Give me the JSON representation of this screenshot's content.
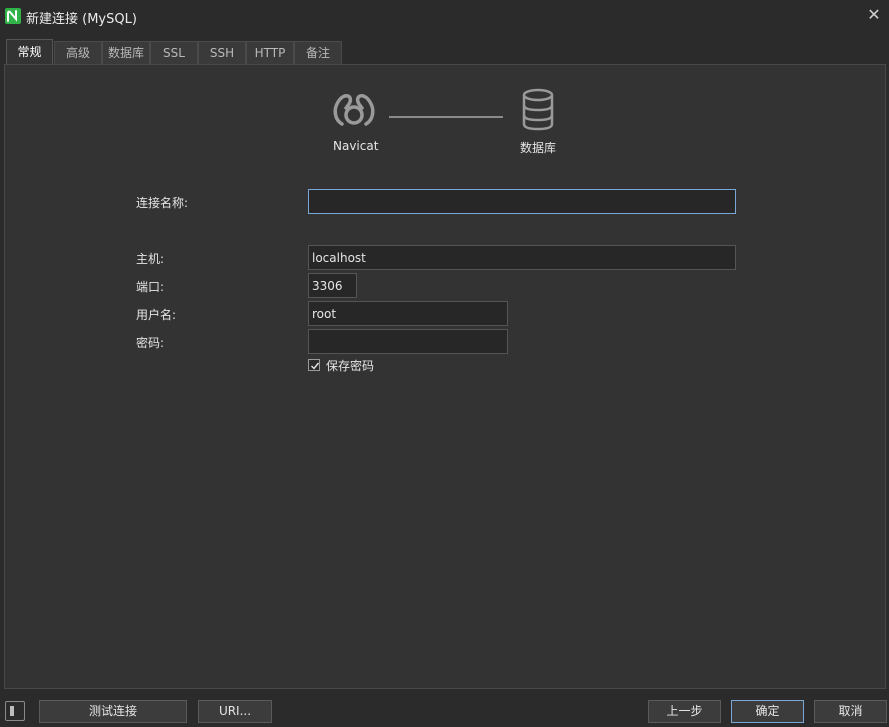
{
  "window": {
    "title": "新建连接 (MySQL)",
    "close_icon": "close-icon"
  },
  "tabs": [
    {
      "label": "常规",
      "active": true
    },
    {
      "label": "高级",
      "active": false
    },
    {
      "label": "数据库",
      "active": false
    },
    {
      "label": "SSL",
      "active": false
    },
    {
      "label": "SSH",
      "active": false
    },
    {
      "label": "HTTP",
      "active": false
    },
    {
      "label": "备注",
      "active": false
    }
  ],
  "diagram": {
    "left_label": "Navicat",
    "right_label": "数据库"
  },
  "form": {
    "connection_name_label": "连接名称:",
    "connection_name_value": "",
    "host_label": "主机:",
    "host_value": "localhost",
    "port_label": "端口:",
    "port_value": "3306",
    "username_label": "用户名:",
    "username_value": "root",
    "password_label": "密码:",
    "password_value": "",
    "save_password_label": "保存密码",
    "save_password_checked": true
  },
  "buttons": {
    "test_connection": "测试连接",
    "uri": "URI...",
    "previous": "上一步",
    "ok": "确定",
    "cancel": "取消"
  },
  "colors": {
    "background": "#2b2b2b",
    "panel": "#333333",
    "focus_accent": "#7aa7d6",
    "app_icon": "#31b34a"
  }
}
